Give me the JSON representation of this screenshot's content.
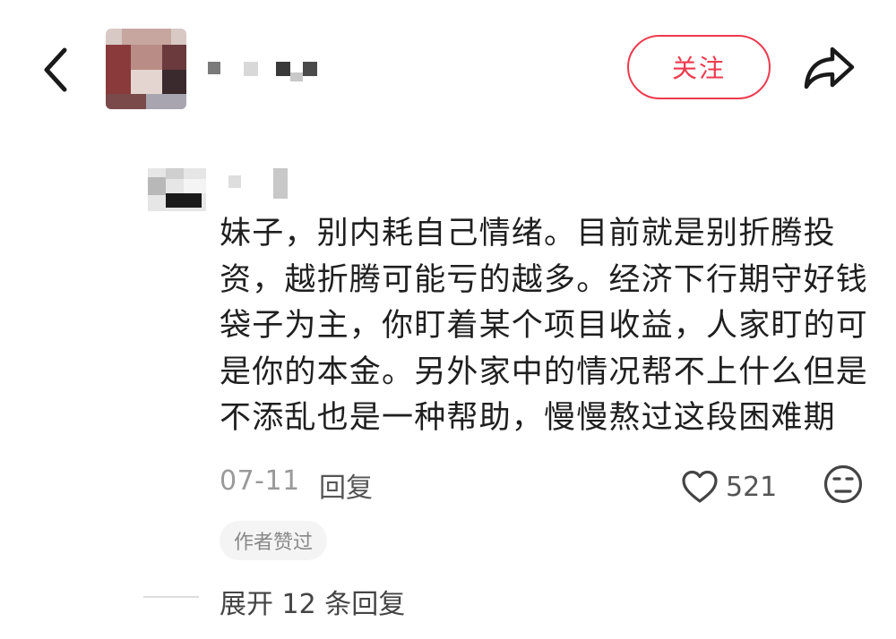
{
  "header": {
    "back_icon": "chevron-left-icon",
    "author_name": "",
    "follow_label": "关注",
    "share_icon": "share-arrow-icon",
    "accent_color": "#ee3a4e"
  },
  "comment": {
    "author_name": "",
    "text_lines": [
      "妹子，别内耗自己情绪。目前就是别折腾投",
      "资，越折腾可能亏的越多。经济下行期守好钱",
      "袋子为主，你盯着某个项目收益，人家盯的可",
      "是你的本金。另外家中的情况帮不上什么但是",
      "不添乱也是一种帮助，慢慢熬过这段困难期"
    ],
    "date": "07-11",
    "reply_label": "回复",
    "like_count": "521",
    "like_icon": "heart-outline-icon",
    "dislike_icon": "sad-face-icon",
    "author_liked_badge": "作者赞过",
    "expand_label": "展开 12 条回复"
  }
}
